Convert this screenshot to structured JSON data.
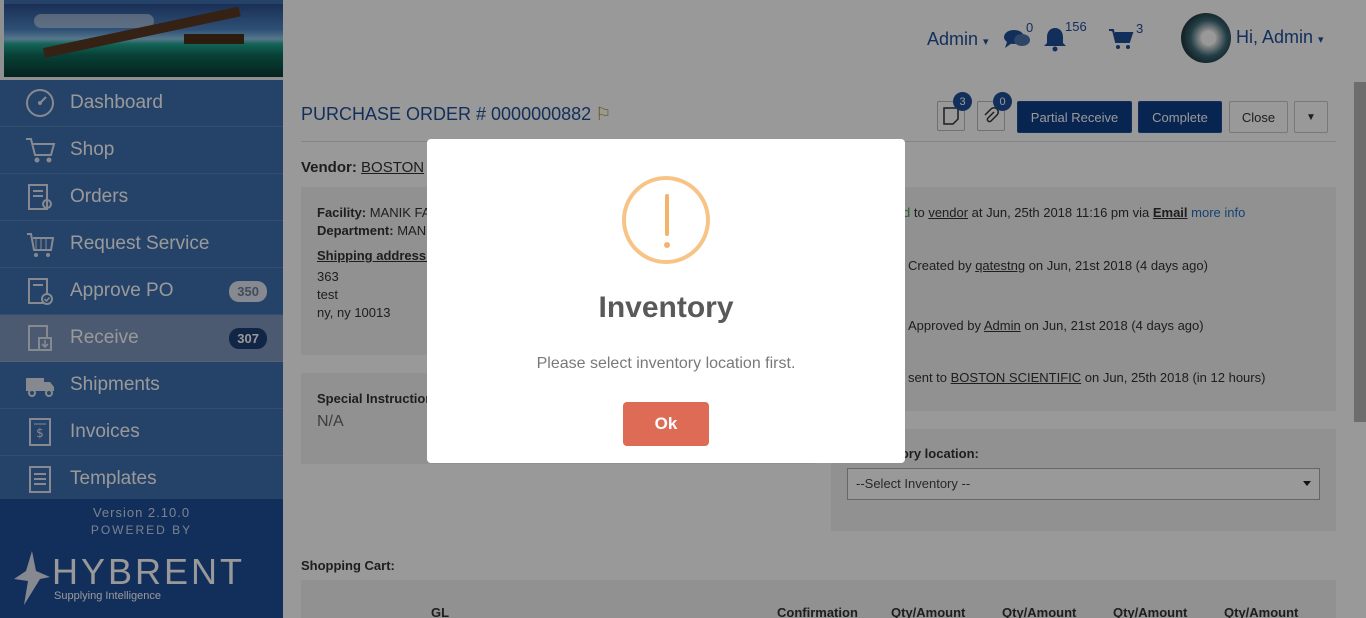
{
  "header": {
    "admin_menu": "Admin",
    "messages_count": "0",
    "notifications_count": "156",
    "cart_count": "3",
    "greeting": "Hi, Admin"
  },
  "sidebar": {
    "items": [
      {
        "label": "Dashboard",
        "icon": "dashboard-icon"
      },
      {
        "label": "Shop",
        "icon": "cart-icon"
      },
      {
        "label": "Orders",
        "icon": "orders-icon"
      },
      {
        "label": "Request Service",
        "icon": "request-service-icon"
      },
      {
        "label": "Approve PO",
        "icon": "approve-icon",
        "badge": "350"
      },
      {
        "label": "Receive",
        "icon": "receive-icon",
        "badge": "307"
      },
      {
        "label": "Shipments",
        "icon": "truck-icon"
      },
      {
        "label": "Invoices",
        "icon": "invoice-icon"
      },
      {
        "label": "Templates",
        "icon": "templates-icon"
      }
    ],
    "version": "Version 2.10.0",
    "powered_by": "POWERED BY",
    "brand": "HYBRENT",
    "tagline": "Supplying Intelligence"
  },
  "po": {
    "title": "PURCHASE ORDER # 0000000882",
    "notes_count": "3",
    "attachments_count": "0",
    "btn_partial": "Partial Receive",
    "btn_complete": "Complete",
    "btn_close": "Close",
    "vendor_label": "Vendor:",
    "vendor_value": "BOSTON",
    "facility_label": "Facility:",
    "facility_value": "MANIK FA",
    "department_label": "Department:",
    "department_value": "MAN",
    "shipping_label": "Shipping address:",
    "addr1": "363",
    "addr2": "test",
    "addr3": "ny, ny 10013",
    "special_label": "Special Instruction",
    "special_value": "N/A",
    "history": {
      "r1_a": "d",
      "r1_b": " to ",
      "r1_vendor": "vendor",
      "r1_c": " at Jun, 25th 2018 11:16 pm via ",
      "r1_email": "Email",
      "r1_more": "more info",
      "r2_a": "Created by ",
      "r2_user": "qatestng",
      "r2_b": " on Jun, 21st 2018 (4 days ago)",
      "r3_a": "Approved by ",
      "r3_user": "Admin",
      "r3_b": " on Jun, 21st 2018 (4 days ago)",
      "r4_a": "sent to ",
      "r4_vendor": "BOSTON SCIENTIFIC",
      "r4_b": " on Jun, 25th 2018 (in 12 hours)"
    },
    "inventory_label": "n inventory location:",
    "inventory_select": "--Select Inventory --",
    "cart_label": "Shopping Cart:",
    "cart_headers": [
      "GL",
      "Confirmation",
      "Qty/Amount",
      "Qty/Amount",
      "Qty/Amount",
      "Qty/Amount"
    ]
  },
  "modal": {
    "title": "Inventory",
    "message": "Please select inventory location first.",
    "ok_label": "Ok",
    "icon": "warning-icon",
    "accent": "#dd6b55"
  }
}
